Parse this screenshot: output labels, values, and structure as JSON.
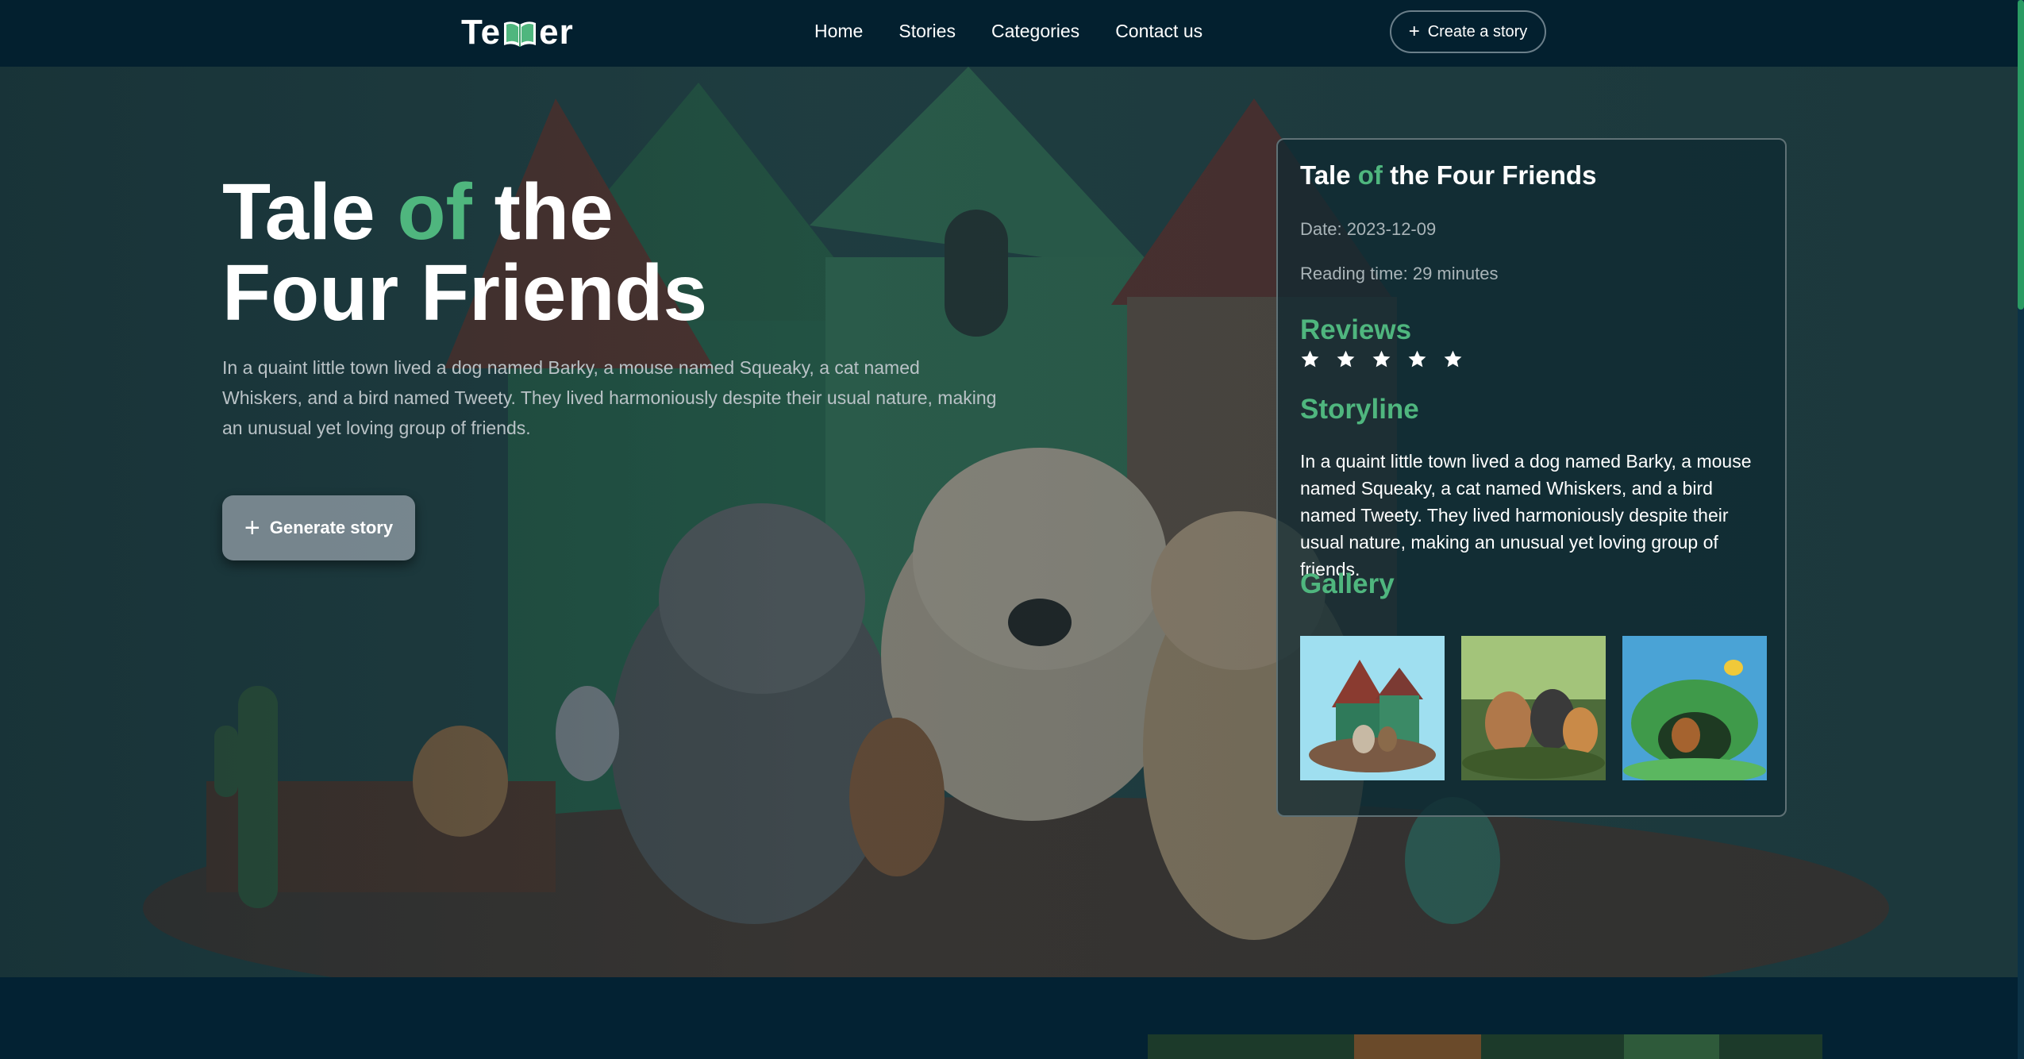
{
  "nav": {
    "logo_left": "Te",
    "logo_right": "er",
    "links": [
      "Home",
      "Stories",
      "Categories",
      "Contact us"
    ],
    "create_label": "Create a story",
    "plus_icon": "plus-icon"
  },
  "hero": {
    "title_part1": "Tale ",
    "title_accent": "of",
    "title_part2": " the",
    "title_line2": "Four Friends",
    "description": "In a quaint little town lived a dog named Barky, a mouse named Squeaky, a cat named Whiskers, and a bird named Tweety. They lived harmoniously despite their usual nature, making an unusual yet loving group of friends.",
    "generate_label": "Generate story"
  },
  "card": {
    "title_part1": "Tale ",
    "title_accent": "of",
    "title_part2": " the Four Friends",
    "date": "Date: 2023-12-09",
    "reading_time": "Reading time: 29 minutes",
    "reviews_heading": "Reviews",
    "rating": 5,
    "storyline_heading": "Storyline",
    "storyline": "In a quaint little town lived a dog named Barky, a mouse named Squeaky, a cat named Whiskers, and a bird named Tweety. They lived harmoniously despite their usual nature, making an unusual yet loving group of friends.",
    "gallery_heading": "Gallery"
  },
  "colors": {
    "accent": "#4fb67e",
    "navbar": "#03202f",
    "background": "#032233"
  }
}
